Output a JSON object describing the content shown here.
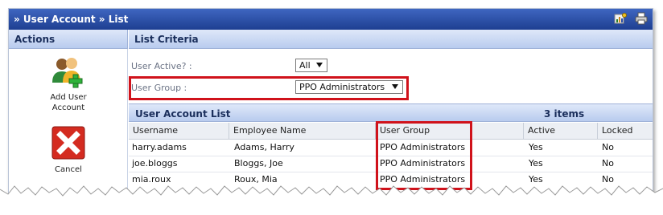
{
  "window": {
    "title": "» User Account » List",
    "icons": [
      "settings-chart-icon",
      "printer-icon"
    ]
  },
  "actions": {
    "header": "Actions",
    "add_user": {
      "label_line1": "Add User",
      "label_line2": "Account"
    },
    "cancel": {
      "label": "Cancel"
    }
  },
  "criteria": {
    "header": "List Criteria",
    "user_active": {
      "label": "User Active? :",
      "value": "All"
    },
    "user_group": {
      "label": "User Group :",
      "value": "PPO Administrators"
    }
  },
  "list": {
    "title": "User Account List",
    "count": "3 items",
    "columns": [
      "Username",
      "Employee Name",
      "User Group",
      "Active",
      "Locked"
    ],
    "rows": [
      [
        "harry.adams",
        "Adams, Harry",
        "PPO Administrators",
        "Yes",
        "No"
      ],
      [
        "joe.bloggs",
        "Bloggs, Joe",
        "PPO Administrators",
        "Yes",
        "No"
      ],
      [
        "mia.roux",
        "Roux, Mia",
        "PPO Administrators",
        "Yes",
        "No"
      ]
    ]
  },
  "colors": {
    "highlight": "#d0121b",
    "titlebar": "#2a4ea6",
    "header": "#c9d8f3"
  }
}
